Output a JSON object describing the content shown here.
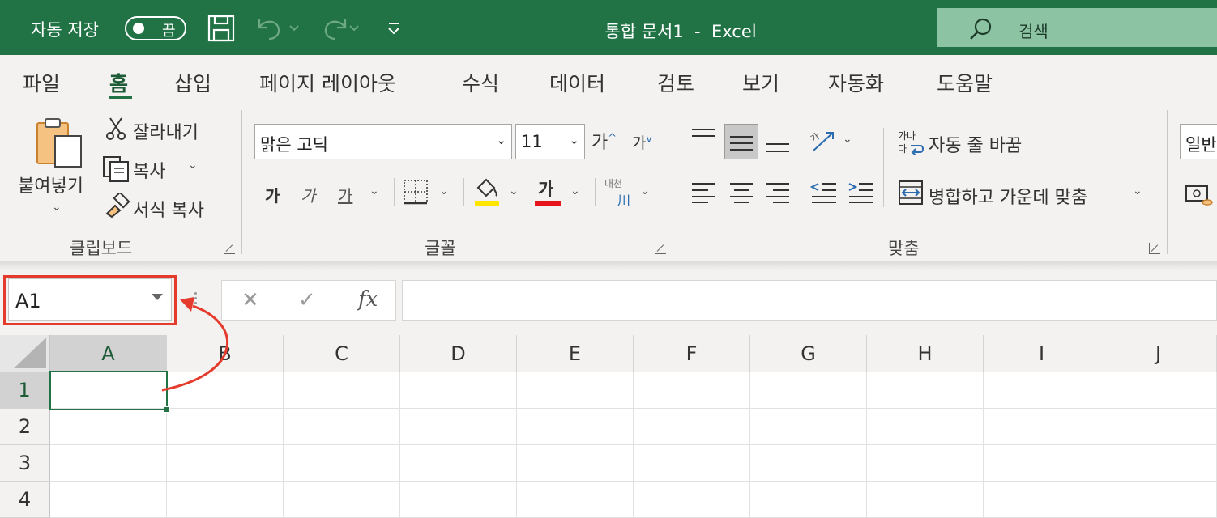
{
  "titlebar": {
    "autosave_label": "자동 저장",
    "autosave_state": "끔",
    "title": "통합 문서1  -  Excel",
    "search_label": "검색"
  },
  "tabs": [
    {
      "label": "파일"
    },
    {
      "label": "홈",
      "active": true
    },
    {
      "label": "삽입"
    },
    {
      "label": "페이지 레이아웃"
    },
    {
      "label": "수식"
    },
    {
      "label": "데이터"
    },
    {
      "label": "검토"
    },
    {
      "label": "보기"
    },
    {
      "label": "자동화"
    },
    {
      "label": "도움말"
    }
  ],
  "clipboard": {
    "paste_label": "붙여넣기",
    "cut_label": "잘라내기",
    "copy_label": "복사",
    "format_painter_label": "서식 복사",
    "group_label": "클립보드"
  },
  "font": {
    "font_name": "맑은 고딕",
    "font_size": "11",
    "increase_label": "가",
    "decrease_label": "가",
    "bold_label": "가",
    "italic_label": "가",
    "underline_label": "가",
    "font_color_label": "가",
    "phonetic_label": "내천",
    "group_label": "글꼴"
  },
  "alignment": {
    "wrap_text_label": "자동 줄 바꿈",
    "merge_center_label": "병합하고 가운데 맞춤",
    "group_label": "맞춤",
    "wrap_icon_text": "가나"
  },
  "number": {
    "format_value": "일반"
  },
  "formula_bar": {
    "name_box_value": "A1",
    "fx_label": "fx",
    "formula_value": ""
  },
  "grid": {
    "columns": [
      "A",
      "B",
      "C",
      "D",
      "E",
      "F",
      "G",
      "H",
      "I",
      "J"
    ],
    "rows": [
      "1",
      "2",
      "3",
      "4"
    ],
    "active_cell": "A1"
  },
  "colors": {
    "excel_green": "#217346",
    "annotation_red": "#e53b2c",
    "search_box": "#8bc3a3"
  }
}
